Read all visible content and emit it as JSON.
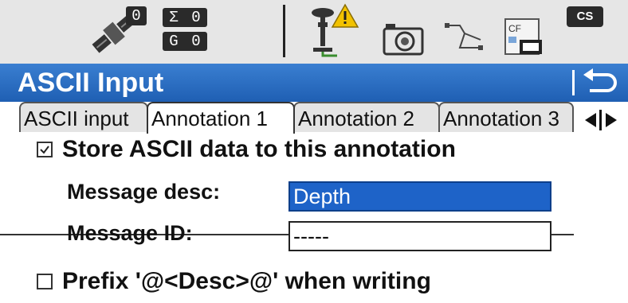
{
  "status_bar": {
    "satellite_count": "0",
    "sum_symbol": "Σ",
    "sum_value": "0",
    "g_label": "G",
    "g_value": "0",
    "cs_label": "CS",
    "icons": [
      "satellite-icon",
      "antenna-warning-icon",
      "camera-icon",
      "line-sketch-icon",
      "cf-card-icon"
    ]
  },
  "title_bar": {
    "title": "ASCII Input"
  },
  "tabs": [
    {
      "label": "ASCII input",
      "active": false
    },
    {
      "label": "Annotation 1",
      "active": true
    },
    {
      "label": "Annotation 2",
      "active": false
    },
    {
      "label": "Annotation 3",
      "active": false
    }
  ],
  "form": {
    "store_checkbox": {
      "label": "Store ASCII data to this annotation",
      "checked": true
    },
    "message_desc": {
      "label": "Message desc:",
      "value": "Depth"
    },
    "message_id": {
      "label": "Message ID:",
      "value": "-----"
    },
    "prefix_checkbox": {
      "label": "Prefix '@<Desc>@' when writing",
      "checked": false
    }
  },
  "colors": {
    "title_bar": "#1f5fb3",
    "selected_field": "#1e63c8",
    "status_bar": "#e6e6e6",
    "warning": "#f2c200"
  }
}
